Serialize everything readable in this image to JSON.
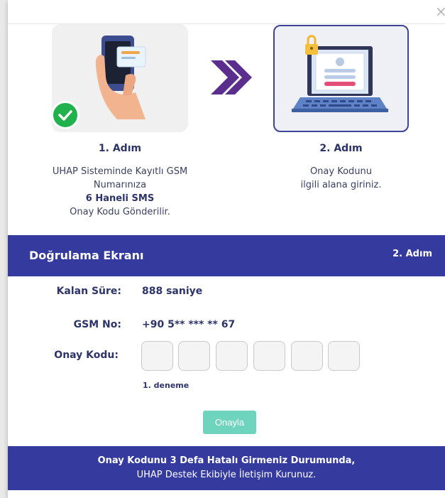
{
  "dialog": {
    "close_symbol": "×"
  },
  "steps": [
    {
      "title": "1. Adım",
      "desc_line1": "UHAP Sisteminde Kayıtlı GSM",
      "desc_line2": "Numarınıza",
      "desc_bold": "6 Haneli SMS",
      "desc_line4": "Onay Kodu Gönderilir.",
      "icon": "phone-sms-illustration",
      "completed": true
    },
    {
      "title": "2. Adım",
      "desc_line1": "Onay Kodunu",
      "desc_line2": "ilgili alana giriniz.",
      "icon": "laptop-lock-illustration",
      "active": true
    }
  ],
  "verification": {
    "header_title": "Doğrulama Ekranı",
    "header_step": "2. Adım",
    "remaining_label": "Kalan Süre:",
    "remaining_value": "888 saniye",
    "gsm_label": "GSM No:",
    "gsm_value": "+90 5** *** ** 67",
    "code_label": "Onay Kodu:",
    "code_digits": [
      "",
      "",
      "",
      "",
      "",
      ""
    ],
    "attempt_text": "1. deneme",
    "confirm_label": "Onayla"
  },
  "footer": {
    "line1": "Onay Kodunu 3 Defa Hatalı Girmeniz Durumunda,",
    "line2": "UHAP Destek Ekibiyle İletişim Kurunuz."
  },
  "colors": {
    "primary": "#343a9e",
    "accent_purple": "#5b2d8c",
    "success": "#21b14d",
    "confirm_button": "#6fd4bd"
  }
}
